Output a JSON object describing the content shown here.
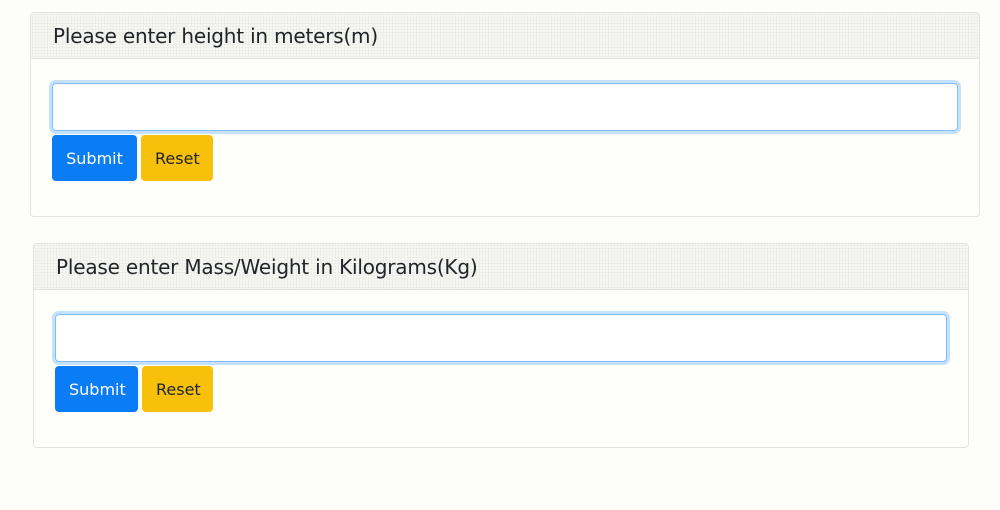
{
  "height_form": {
    "title": "Please enter height in meters(m)",
    "input_value": "",
    "submit_label": "Submit",
    "reset_label": "Reset"
  },
  "mass_form": {
    "title": "Please enter Mass/Weight in Kilograms(Kg)",
    "input_value": "",
    "submit_label": "Submit",
    "reset_label": "Reset"
  },
  "colors": {
    "primary": "#0a7cf6",
    "warning": "#f7c10b",
    "focus_border": "#80bdff"
  }
}
